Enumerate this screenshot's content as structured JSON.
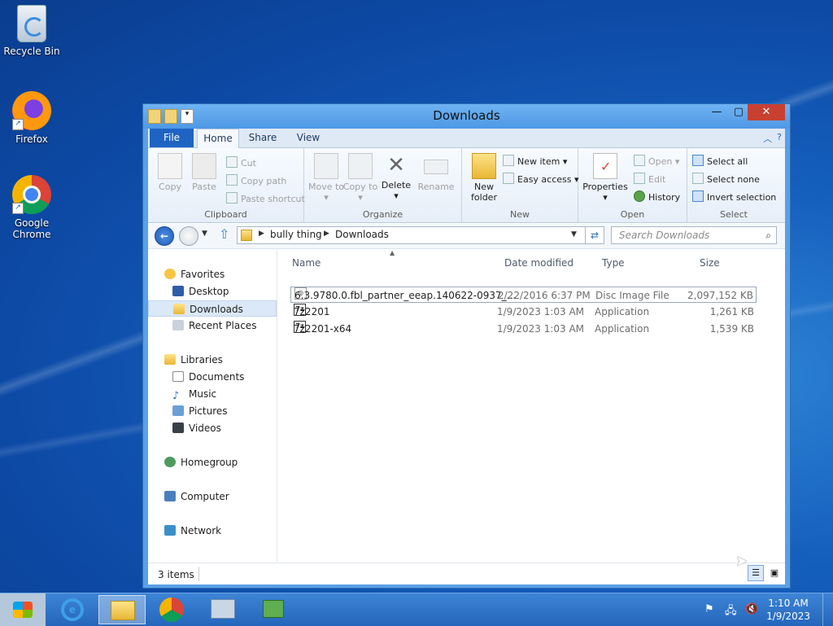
{
  "desktop": {
    "icons": [
      {
        "label": "Recycle Bin"
      },
      {
        "label": "Firefox"
      },
      {
        "label": "Google Chrome"
      }
    ]
  },
  "window": {
    "title": "Downloads",
    "controls": {
      "minimize": "—",
      "maximize": "▢",
      "close": "✕"
    }
  },
  "ribbon": {
    "tabs": {
      "file": "File",
      "home": "Home",
      "share": "Share",
      "view": "View"
    },
    "clipboard": {
      "label": "Clipboard",
      "copy": "Copy",
      "paste": "Paste",
      "cut": "Cut",
      "copy_path": "Copy path",
      "paste_shortcut": "Paste shortcut"
    },
    "organize": {
      "label": "Organize",
      "move_to": "Move to ▾",
      "copy_to": "Copy to ▾",
      "delete": "Delete",
      "delete_arrow": "▾",
      "rename": "Rename"
    },
    "new": {
      "label": "New",
      "new_folder": "New folder",
      "new_item": "New item ▾",
      "easy_access": "Easy access ▾"
    },
    "open": {
      "label": "Open",
      "properties": "Properties",
      "properties_arrow": "▾",
      "open": "Open ▾",
      "edit": "Edit",
      "history": "History"
    },
    "select": {
      "label": "Select",
      "select_all": "Select all",
      "select_none": "Select none",
      "invert_selection": "Invert selection"
    }
  },
  "address": {
    "segments": [
      "bully thing",
      "Downloads"
    ],
    "search_placeholder": "Search Downloads"
  },
  "nav": {
    "favorites": "Favorites",
    "desktop": "Desktop",
    "downloads": "Downloads",
    "recent_places": "Recent Places",
    "libraries": "Libraries",
    "documents": "Documents",
    "music": "Music",
    "pictures": "Pictures",
    "videos": "Videos",
    "homegroup": "Homegroup",
    "computer": "Computer",
    "network": "Network"
  },
  "files": {
    "columns": {
      "name": "Name",
      "date": "Date modified",
      "type": "Type",
      "size": "Size"
    },
    "rows": [
      {
        "name": "6.3.9780.0.fbl_partner_eeap.140622-0937_...",
        "date": "2/22/2016 6:37 PM",
        "type": "Disc Image File",
        "size": "2,097,152 KB"
      },
      {
        "name": "7z2201",
        "date": "1/9/2023 1:03 AM",
        "type": "Application",
        "size": "1,261 KB"
      },
      {
        "name": "7z2201-x64",
        "date": "1/9/2023 1:03 AM",
        "type": "Application",
        "size": "1,539 KB"
      }
    ]
  },
  "status": {
    "count": "3 items"
  },
  "taskbar": {
    "time": "1:10 AM",
    "date": "1/9/2023"
  }
}
